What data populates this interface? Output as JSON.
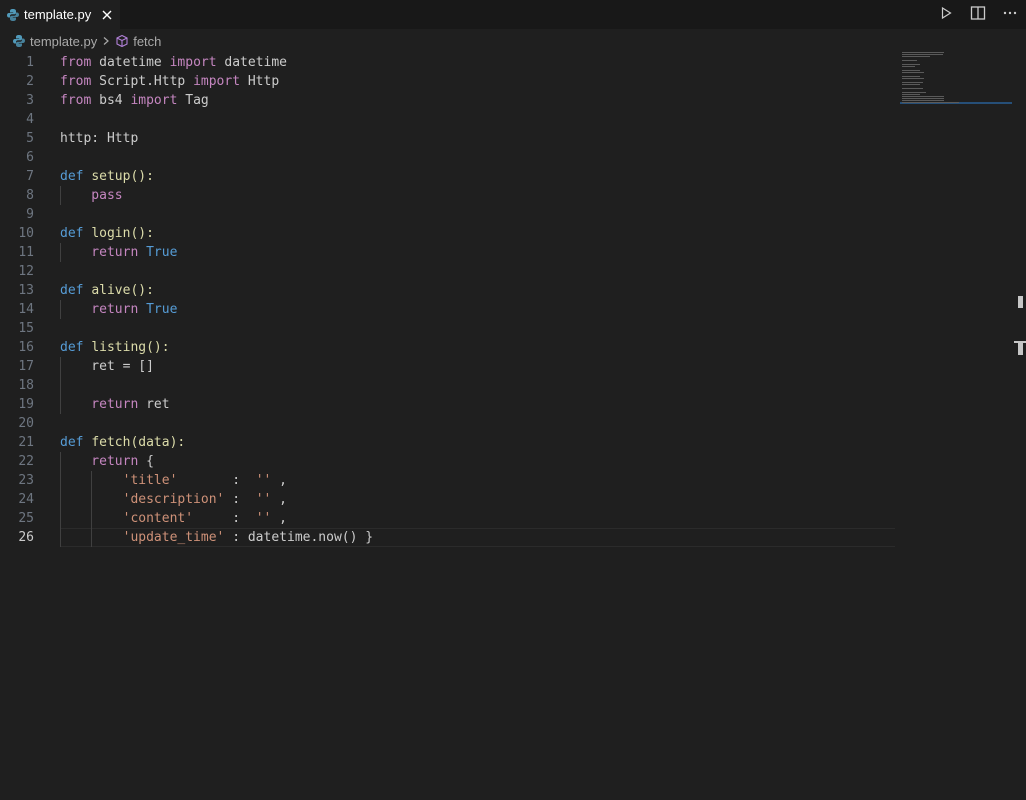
{
  "tab": {
    "filename": "template.py",
    "icon": "python-icon",
    "close_icon": "close-icon"
  },
  "actions": [
    {
      "name": "run-button",
      "icon": "play-icon"
    },
    {
      "name": "split-editor-button",
      "icon": "split-icon"
    },
    {
      "name": "more-actions-button",
      "icon": "ellipsis-icon"
    }
  ],
  "breadcrumb": {
    "file": "template.py",
    "symbol": "fetch"
  },
  "editor": {
    "active_line": 26,
    "lines": [
      {
        "n": "1",
        "t": [
          [
            "kw-ctrl",
            "from"
          ],
          [
            "",
            "datetime"
          ],
          [
            "kw-ctrl",
            "import"
          ],
          [
            "",
            "datetime"
          ]
        ]
      },
      {
        "n": "2",
        "t": [
          [
            "kw-ctrl",
            "from"
          ],
          [
            "",
            "Script.Http"
          ],
          [
            "kw-ctrl",
            "import"
          ],
          [
            "",
            "Http"
          ]
        ]
      },
      {
        "n": "3",
        "t": [
          [
            "kw-ctrl",
            "from"
          ],
          [
            "",
            "bs4"
          ],
          [
            "kw-ctrl",
            "import"
          ],
          [
            "",
            "Tag"
          ]
        ]
      },
      {
        "n": "4",
        "t": []
      },
      {
        "n": "5",
        "t": [
          [
            "",
            "http: Http"
          ]
        ]
      },
      {
        "n": "6",
        "t": []
      },
      {
        "n": "7",
        "t": [
          [
            "kw-def",
            "def"
          ],
          [
            "fn",
            "setup():"
          ]
        ]
      },
      {
        "n": "8",
        "t": [
          [
            "kw-ctrl",
            "    pass"
          ]
        ]
      },
      {
        "n": "9",
        "t": []
      },
      {
        "n": "10",
        "t": [
          [
            "kw-def",
            "def"
          ],
          [
            "fn",
            "login():"
          ]
        ]
      },
      {
        "n": "11",
        "t": [
          [
            "kw-ctrl",
            "    return"
          ],
          [
            "kw-def",
            "True"
          ]
        ]
      },
      {
        "n": "12",
        "t": []
      },
      {
        "n": "13",
        "t": [
          [
            "kw-def",
            "def"
          ],
          [
            "fn",
            "alive():"
          ]
        ]
      },
      {
        "n": "14",
        "t": [
          [
            "kw-ctrl",
            "    return"
          ],
          [
            "kw-def",
            "True"
          ]
        ]
      },
      {
        "n": "15",
        "t": []
      },
      {
        "n": "16",
        "t": [
          [
            "kw-def",
            "def"
          ],
          [
            "fn",
            "listing():"
          ]
        ]
      },
      {
        "n": "17",
        "t": [
          [
            "",
            "    ret = []"
          ]
        ]
      },
      {
        "n": "18",
        "t": []
      },
      {
        "n": "19",
        "t": [
          [
            "kw-ctrl",
            "    return"
          ],
          [
            "",
            "ret"
          ]
        ]
      },
      {
        "n": "20",
        "t": []
      },
      {
        "n": "21",
        "t": [
          [
            "kw-def",
            "def"
          ],
          [
            "fn",
            "fetch(data):"
          ]
        ]
      },
      {
        "n": "22",
        "t": [
          [
            "kw-ctrl",
            "    return"
          ],
          [
            "",
            "{"
          ]
        ]
      },
      {
        "n": "23",
        "t": [
          [
            "str",
            "        'title'"
          ],
          [
            "",
            "      : "
          ],
          [
            "str",
            "''"
          ],
          [
            "",
            ","
          ]
        ]
      },
      {
        "n": "24",
        "t": [
          [
            "str",
            "        'description'"
          ],
          [
            "",
            ": "
          ],
          [
            "str",
            "''"
          ],
          [
            "",
            ","
          ]
        ]
      },
      {
        "n": "25",
        "t": [
          [
            "str",
            "        'content'"
          ],
          [
            "",
            "    : "
          ],
          [
            "str",
            "''"
          ],
          [
            "",
            ","
          ]
        ]
      },
      {
        "n": "26",
        "t": [
          [
            "str",
            "        'update_time'"
          ],
          [
            "",
            ": datetime.now() }"
          ]
        ]
      }
    ]
  }
}
